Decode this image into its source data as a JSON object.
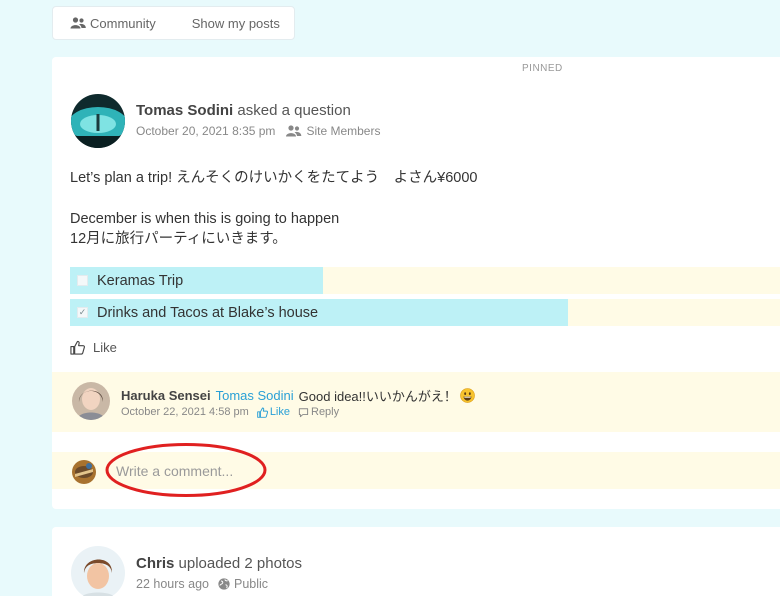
{
  "filter_bar": {
    "community_label": "Community",
    "mine_label": "Show my posts"
  },
  "post": {
    "pinned_label": "PINNED",
    "author": "Tomas Sodini",
    "action": "asked a question",
    "date": "October 20, 2021 8:35 pm",
    "audience": "Site Members",
    "body_line1": "Let’s plan a trip! えんそくのけいかくをたてよう　よさん¥6000",
    "body_line2": "December is when this is going to happen",
    "body_line3": "12月に旅行パーティにいきます。",
    "poll_options": [
      {
        "label": "Keramas Trip",
        "share": 0.35,
        "checked": false
      },
      {
        "label": "Drinks and Tacos at Blake’s house",
        "share": 0.69,
        "checked": true
      }
    ],
    "like_label": "Like"
  },
  "comment": {
    "author": "Haruka Sensei",
    "mention": "Tomas Sodini",
    "text": "Good idea!!いいかんがえ！",
    "date": "October 22, 2021 4:58 pm",
    "like_label": "Like",
    "reply_label": "Reply"
  },
  "composer": {
    "placeholder": "Write a comment..."
  },
  "post2": {
    "author": "Chris",
    "action": "uploaded 2 photos",
    "time": "22 hours ago",
    "audience": "Public"
  },
  "colors": {
    "background": "#e8fafc",
    "poll_fill": "#bdf1f6",
    "poll_track": "#fffbe6",
    "link": "#2aa0d6",
    "annotation": "#e02020"
  }
}
